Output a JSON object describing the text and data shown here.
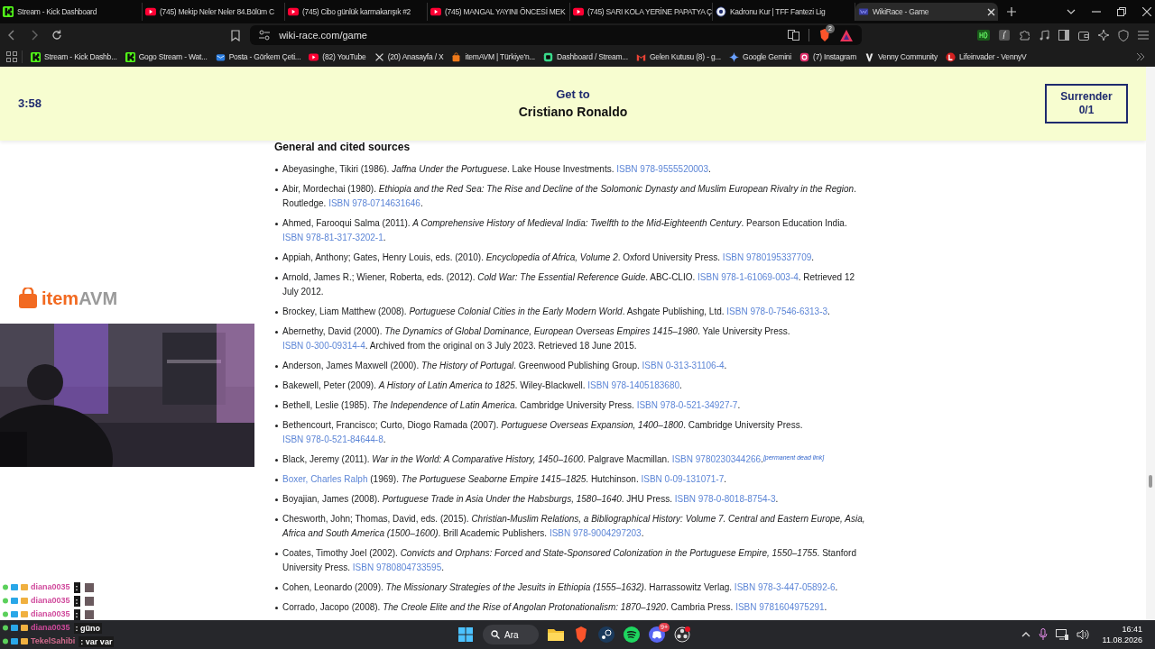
{
  "browser": {
    "tabs": [
      {
        "title": "Stream - Kick Dashboard",
        "kind": "kick",
        "selected": false
      },
      {
        "title": "(745) Mekip Neler Neler 84.Bölüm C",
        "kind": "youtube",
        "selected": false
      },
      {
        "title": "(745) Cibo günlük karmakarışık #2",
        "kind": "youtube",
        "selected": false
      },
      {
        "title": "(745) MANGAL YAYINI ÖNCESİ MEK",
        "kind": "youtube",
        "selected": false
      },
      {
        "title": "(745) SARI KOLA YERİNE PAPATYA Ç",
        "kind": "youtube",
        "selected": false
      },
      {
        "title": "Kadronu Kur | TFF Fantezi Lig",
        "kind": "ball",
        "selected": false
      },
      {
        "title": "WikiRace - Game",
        "kind": "wiki",
        "selected": true
      }
    ],
    "address": "wiki-race.com/game",
    "shields_count": "2",
    "bookmarks": [
      {
        "label": "Stream - Kick Dashb...",
        "kind": "kick"
      },
      {
        "label": "Gogo Stream - Wat...",
        "kind": "kick"
      },
      {
        "label": "Posta - Görkem Çeti...",
        "kind": "mail"
      },
      {
        "label": "(82) YouTube",
        "kind": "youtube"
      },
      {
        "label": "(20) Anasayfa / X",
        "kind": "x"
      },
      {
        "label": "itemAVM | Türkiye'n...",
        "kind": "bag"
      },
      {
        "label": "Dashboard / Stream...",
        "kind": "dash"
      },
      {
        "label": "Gelen Kutusu (8) - g...",
        "kind": "gmail"
      },
      {
        "label": "Google Gemini",
        "kind": "gemini"
      },
      {
        "label": "(7) Instagram",
        "kind": "instagram"
      },
      {
        "label": "Venny Community",
        "kind": "v"
      },
      {
        "label": "Lifeinvader - VennyV",
        "kind": "l"
      }
    ]
  },
  "game": {
    "timer": "3:58",
    "goal_label": "Get to",
    "goal": "Cristiano Ronaldo",
    "surrender": {
      "label": "Surrender",
      "count": "0/1"
    }
  },
  "article": {
    "heading": "General and cited sources",
    "references": [
      {
        "parts": [
          {
            "kind": "text",
            "text": "Abeyasinghe, Tikiri (1986). "
          },
          {
            "kind": "title",
            "text": "Jaffna Under the Portuguese"
          },
          {
            "kind": "text",
            "text": ". Lake House Investments. "
          },
          {
            "kind": "link",
            "text": "ISBN 978-9555520003"
          },
          {
            "kind": "text",
            "text": "."
          }
        ]
      },
      {
        "parts": [
          {
            "kind": "text",
            "text": "Abir, Mordechai (1980). "
          },
          {
            "kind": "title",
            "text": "Ethiopia and the Red Sea: The Rise and Decline of the Solomonic Dynasty and Muslim European Rivalry in the Region"
          },
          {
            "kind": "text",
            "text": ". Routledge. "
          },
          {
            "kind": "link",
            "text": "ISBN 978-0714631646"
          },
          {
            "kind": "text",
            "text": "."
          }
        ]
      },
      {
        "parts": [
          {
            "kind": "text",
            "text": "Ahmed, Farooqui Salma (2011). "
          },
          {
            "kind": "title",
            "text": "A Comprehensive History of Medieval India: Twelfth to the Mid-Eighteenth Century"
          },
          {
            "kind": "text",
            "text": ". Pearson Education India. "
          },
          {
            "kind": "link",
            "text": "ISBN 978-81-317-3202-1"
          },
          {
            "kind": "text",
            "text": "."
          }
        ]
      },
      {
        "parts": [
          {
            "kind": "text",
            "text": "Appiah, Anthony; Gates, Henry Louis, eds. (2010). "
          },
          {
            "kind": "title",
            "text": "Encyclopedia of Africa, Volume 2"
          },
          {
            "kind": "text",
            "text": ". Oxford University Press. "
          },
          {
            "kind": "link",
            "text": "ISBN 9780195337709"
          },
          {
            "kind": "text",
            "text": "."
          }
        ]
      },
      {
        "parts": [
          {
            "kind": "text",
            "text": "Arnold, James R.; Wiener, Roberta, eds. (2012). "
          },
          {
            "kind": "title",
            "text": "Cold War: The Essential Reference Guide"
          },
          {
            "kind": "text",
            "text": ". ABC-CLIO. "
          },
          {
            "kind": "link",
            "text": "ISBN 978-1-61069-003-4"
          },
          {
            "kind": "text",
            "text": ". Retrieved 12 July 2012."
          }
        ]
      },
      {
        "parts": [
          {
            "kind": "text",
            "text": "Brockey, Liam Matthew (2008). "
          },
          {
            "kind": "title",
            "text": "Portuguese Colonial Cities in the Early Modern World"
          },
          {
            "kind": "text",
            "text": ". Ashgate Publishing, Ltd. "
          },
          {
            "kind": "link",
            "text": "ISBN 978-0-7546-6313-3"
          },
          {
            "kind": "text",
            "text": "."
          }
        ]
      },
      {
        "parts": [
          {
            "kind": "text",
            "text": "Abernethy, David (2000). "
          },
          {
            "kind": "title",
            "text": "The Dynamics of Global Dominance, European Overseas Empires 1415–1980"
          },
          {
            "kind": "text",
            "text": ". Yale University Press. "
          },
          {
            "kind": "link",
            "text": "ISBN 0-300-09314-4"
          },
          {
            "kind": "text",
            "text": ". Archived from the original on 3 July 2023. Retrieved 18 June 2015."
          }
        ]
      },
      {
        "parts": [
          {
            "kind": "text",
            "text": "Anderson, James Maxwell (2000). "
          },
          {
            "kind": "title",
            "text": "The History of Portugal"
          },
          {
            "kind": "text",
            "text": ". Greenwood Publishing Group. "
          },
          {
            "kind": "link",
            "text": "ISBN 0-313-31106-4"
          },
          {
            "kind": "text",
            "text": "."
          }
        ]
      },
      {
        "parts": [
          {
            "kind": "text",
            "text": "Bakewell, Peter (2009). "
          },
          {
            "kind": "title",
            "text": "A History of Latin America to 1825"
          },
          {
            "kind": "text",
            "text": ". Wiley-Blackwell. "
          },
          {
            "kind": "link",
            "text": "ISBN 978-1405183680"
          },
          {
            "kind": "text",
            "text": "."
          }
        ]
      },
      {
        "parts": [
          {
            "kind": "text",
            "text": "Bethell, Leslie (1985). "
          },
          {
            "kind": "title",
            "text": "The Independence of Latin America"
          },
          {
            "kind": "text",
            "text": ". Cambridge University Press. "
          },
          {
            "kind": "link",
            "text": "ISBN 978-0-521-34927-7"
          },
          {
            "kind": "text",
            "text": "."
          }
        ]
      },
      {
        "parts": [
          {
            "kind": "text",
            "text": "Bethencourt, Francisco; Curto, Diogo Ramada (2007). "
          },
          {
            "kind": "title",
            "text": "Portuguese Overseas Expansion, 1400–1800"
          },
          {
            "kind": "text",
            "text": ". Cambridge University Press. "
          },
          {
            "kind": "link",
            "text": "ISBN 978-0-521-84644-8"
          },
          {
            "kind": "text",
            "text": "."
          }
        ]
      },
      {
        "parts": [
          {
            "kind": "text",
            "text": "Black, Jeremy (2011). "
          },
          {
            "kind": "title",
            "text": "War in the World: A Comparative History, 1450–1600"
          },
          {
            "kind": "text",
            "text": ". Palgrave Macmillan. "
          },
          {
            "kind": "link",
            "text": "ISBN 9780230344266"
          },
          {
            "kind": "text",
            "text": "."
          },
          {
            "kind": "note",
            "text": "[permanent dead link]"
          }
        ]
      },
      {
        "parts": [
          {
            "kind": "link",
            "text": "Boxer, Charles Ralph"
          },
          {
            "kind": "text",
            "text": " (1969). "
          },
          {
            "kind": "title",
            "text": "The Portuguese Seaborne Empire 1415–1825"
          },
          {
            "kind": "text",
            "text": ". Hutchinson. "
          },
          {
            "kind": "link",
            "text": "ISBN 0-09-131071-7"
          },
          {
            "kind": "text",
            "text": "."
          }
        ]
      },
      {
        "parts": [
          {
            "kind": "text",
            "text": "Boyajian, James (2008). "
          },
          {
            "kind": "title",
            "text": "Portuguese Trade in Asia Under the Habsburgs, 1580–1640"
          },
          {
            "kind": "text",
            "text": ". JHU Press. "
          },
          {
            "kind": "link",
            "text": "ISBN 978-0-8018-8754-3"
          },
          {
            "kind": "text",
            "text": "."
          }
        ]
      },
      {
        "parts": [
          {
            "kind": "text",
            "text": "Chesworth, John; Thomas, David, eds. (2015). "
          },
          {
            "kind": "title",
            "text": "Christian-Muslim Relations, a Bibliographical History: Volume 7. Central and Eastern Europe, Asia, Africa and South America (1500–1600)"
          },
          {
            "kind": "text",
            "text": ". Brill Academic Publishers. "
          },
          {
            "kind": "link",
            "text": "ISBN 978-9004297203"
          },
          {
            "kind": "text",
            "text": "."
          }
        ]
      },
      {
        "parts": [
          {
            "kind": "text",
            "text": "Coates, Timothy Joel (2002). "
          },
          {
            "kind": "title",
            "text": "Convicts and Orphans: Forced and State-Sponsored Colonization in the Portuguese Empire, 1550–1755"
          },
          {
            "kind": "text",
            "text": ". Stanford University Press. "
          },
          {
            "kind": "link",
            "text": "ISBN 9780804733595"
          },
          {
            "kind": "text",
            "text": "."
          }
        ]
      },
      {
        "parts": [
          {
            "kind": "text",
            "text": "Cohen, Leonardo (2009). "
          },
          {
            "kind": "title",
            "text": "The Missionary Strategies of the Jesuits in Ethiopia (1555–1632)"
          },
          {
            "kind": "text",
            "text": ". Harrassowitz Verlag. "
          },
          {
            "kind": "link",
            "text": "ISBN 978-3-447-05892-6"
          },
          {
            "kind": "text",
            "text": "."
          }
        ]
      },
      {
        "parts": [
          {
            "kind": "text",
            "text": "Corrado, Jacopo (2008). "
          },
          {
            "kind": "title",
            "text": "The Creole Elite and the Rise of Angolan Protonationalism: 1870–1920"
          },
          {
            "kind": "text",
            "text": ". Cambria Press. "
          },
          {
            "kind": "link",
            "text": "ISBN 9781604975291"
          },
          {
            "kind": "text",
            "text": "."
          }
        ]
      }
    ]
  },
  "stream_overlay": {
    "logo": {
      "primary": "item",
      "secondary": "AVM"
    },
    "chat": [
      {
        "user": "diana0035",
        "color": "#d04a9c",
        "text": ":",
        "emote": true
      },
      {
        "user": "diana0035",
        "color": "#d04a9c",
        "text": ":",
        "emote": true
      },
      {
        "user": "diana0035",
        "color": "#d04a9c",
        "text": ":",
        "emote": true
      },
      {
        "user": "diana0035",
        "color": "#d04a9c",
        "text": ": güno",
        "emote": false
      },
      {
        "user": "TekelSahibi",
        "color": "#d06a8c",
        "text": ": var var",
        "emote": false
      }
    ]
  },
  "taskbar": {
    "search": "Ara",
    "discord_badge": "9+",
    "time": "16:41",
    "date": "11.08.2026"
  }
}
